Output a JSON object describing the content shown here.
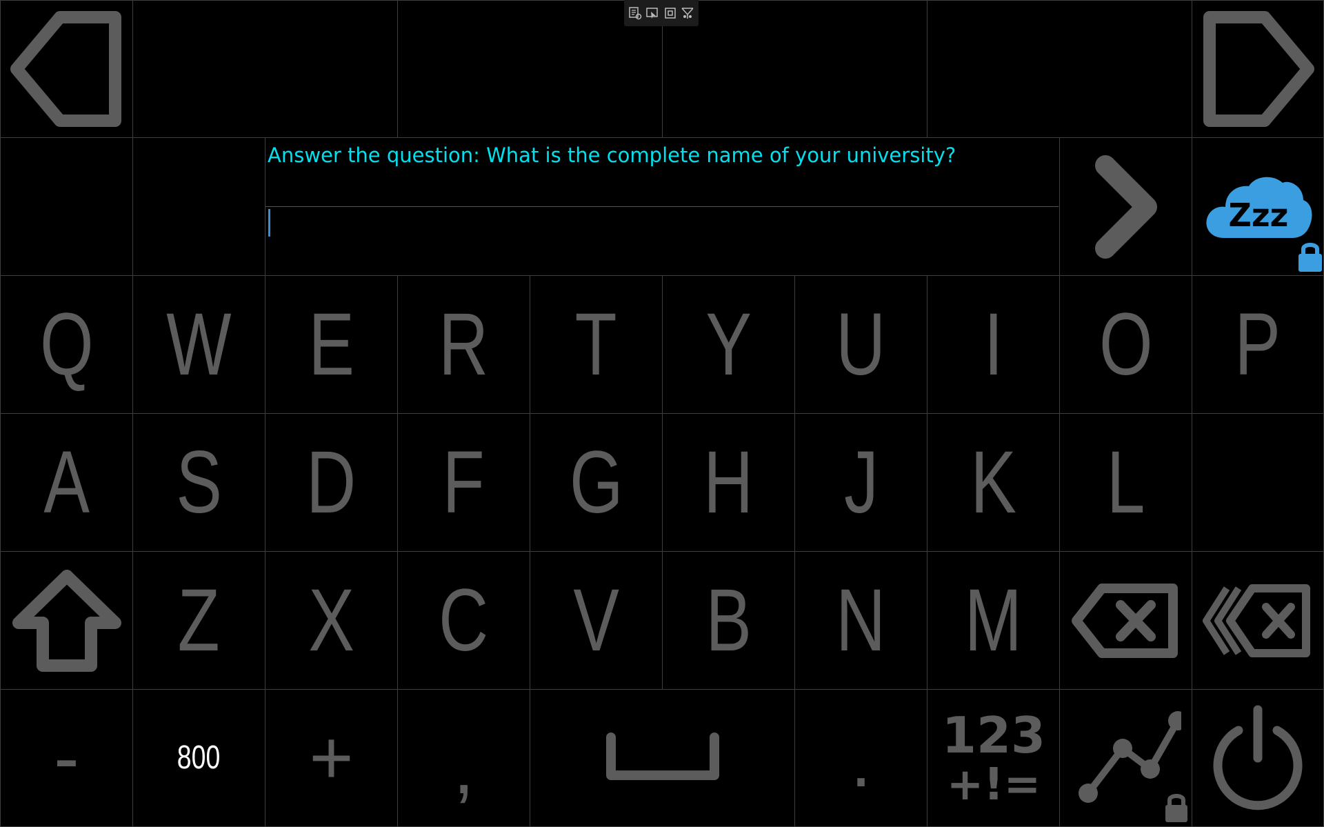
{
  "app": {
    "toolbar_icons": [
      "edit-settings-icon",
      "pointer-icon",
      "frame-icon",
      "network-icon"
    ]
  },
  "nav": {
    "back_icon": "arrow-left-icon",
    "forward_icon": "arrow-right-icon"
  },
  "prompt": {
    "text": "Answer the question: What is the complete name of your university?"
  },
  "answer": {
    "value": ""
  },
  "controls": {
    "submit_icon": "chevron-right-icon",
    "sleep_icon": "sleep-cloud-icon",
    "sleep_label": "Zzz",
    "lock_icon": "lock-icon"
  },
  "keyboard": {
    "row1": [
      "Q",
      "W",
      "E",
      "R",
      "T",
      "Y",
      "U",
      "I",
      "O",
      "P"
    ],
    "row2": [
      "A",
      "S",
      "D",
      "F",
      "G",
      "H",
      "J",
      "K",
      "L"
    ],
    "row3": [
      "Z",
      "X",
      "C",
      "V",
      "B",
      "N",
      "M"
    ],
    "row4": {
      "minus": "-",
      "number": "800",
      "plus": "+",
      "comma": ",",
      "period": "."
    },
    "numbers_icon": {
      "top": "123",
      "bottom": "+!="
    },
    "icons": {
      "shift": "shift-icon",
      "backspace": "backspace-icon",
      "delete_word": "delete-word-icon",
      "space": "space-icon",
      "numbers": "numbers-symbols-icon",
      "graph": "graph-icon",
      "power": "power-icon"
    }
  },
  "colors": {
    "background": "#000000",
    "grid_line": "#3f3f3f",
    "key_text": "#5c5c5c",
    "prompt_text": "#00e0ee",
    "accent_blue": "#3a9ee0",
    "number_text": "#ffffff"
  }
}
